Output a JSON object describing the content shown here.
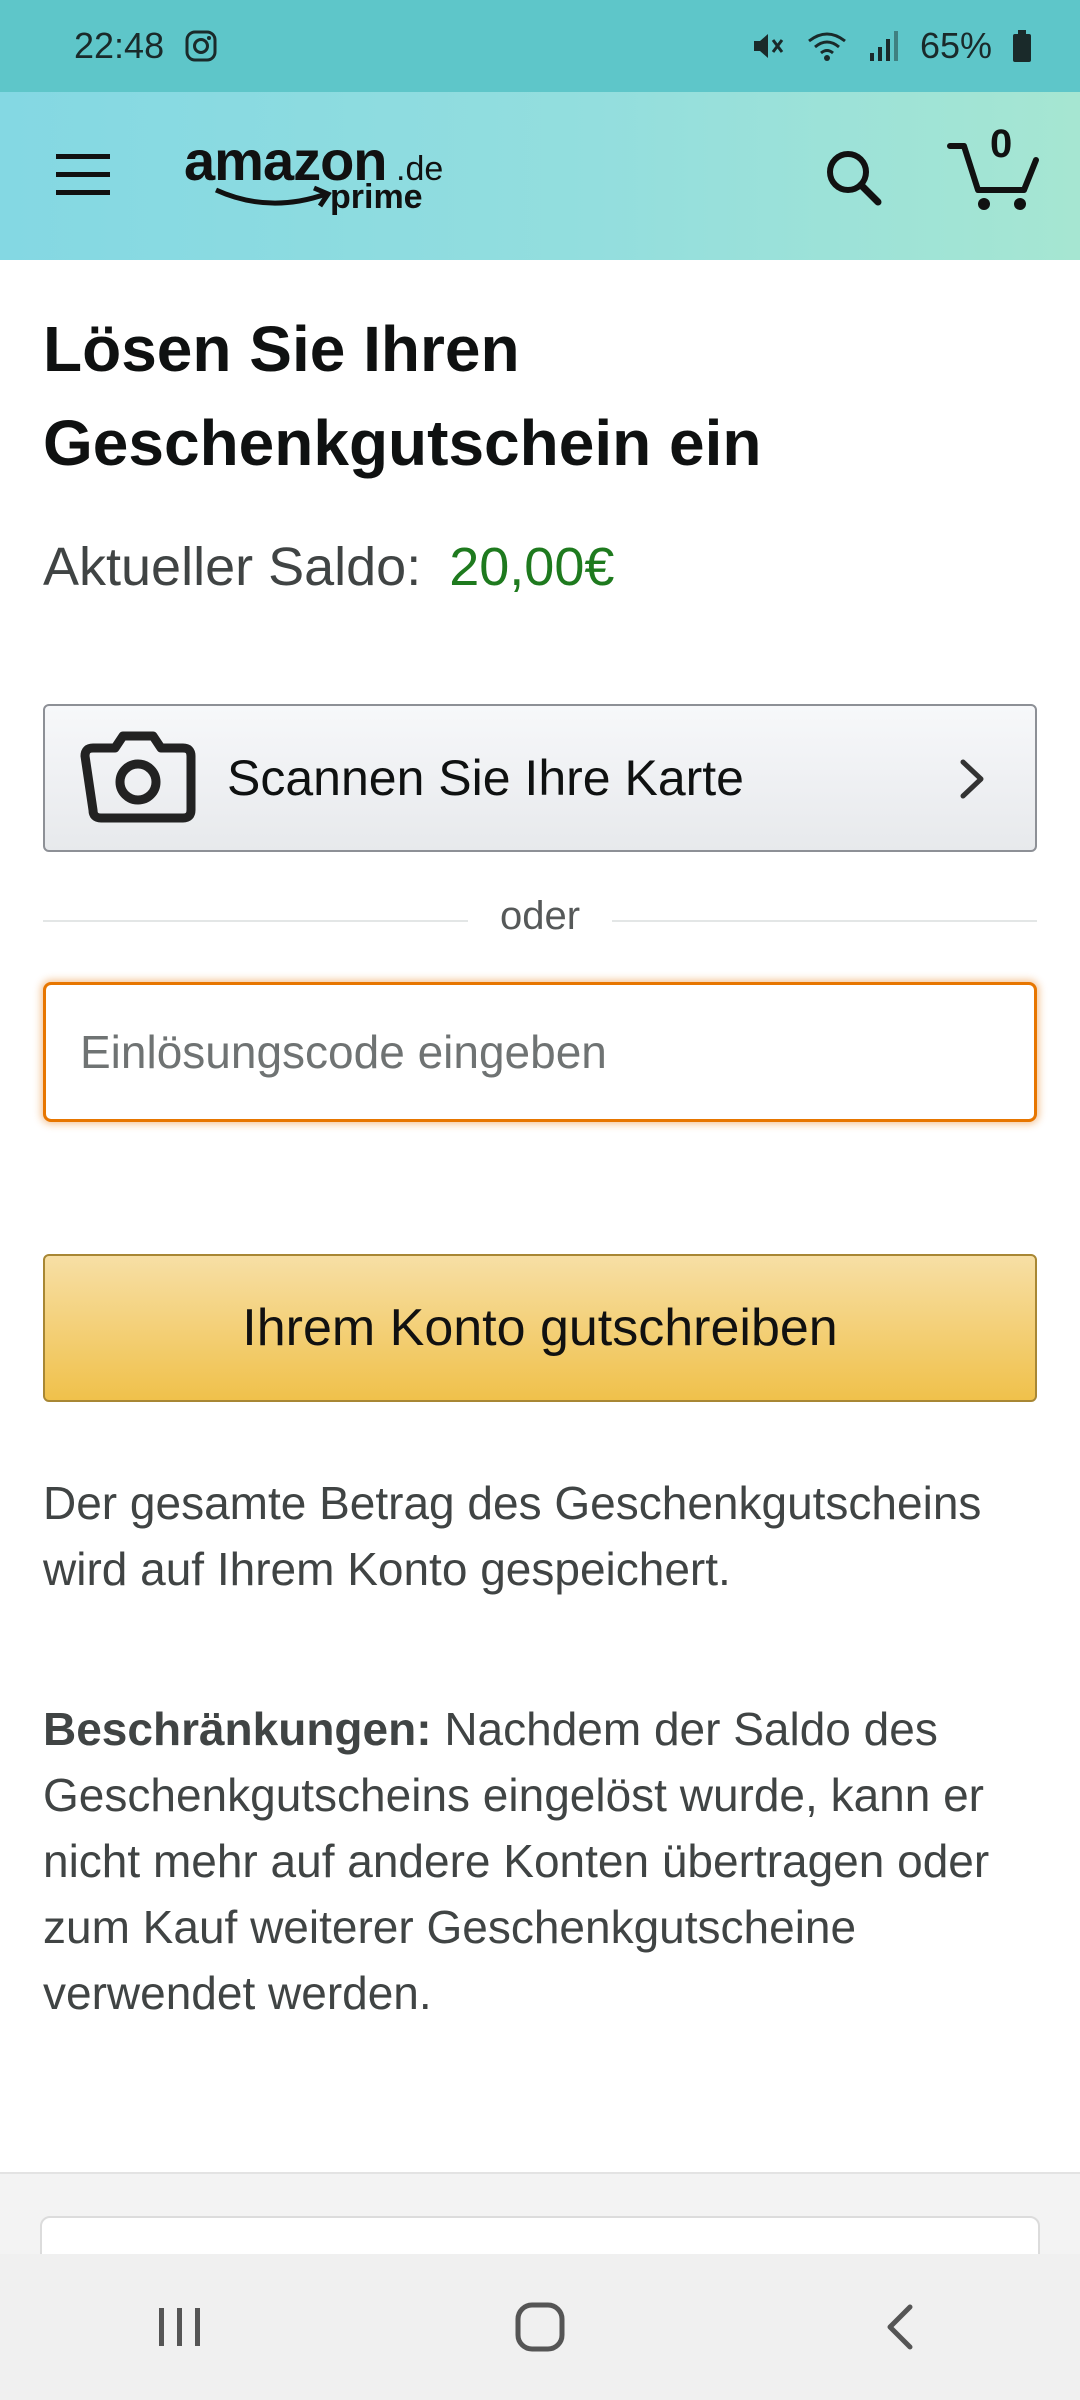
{
  "status_bar": {
    "time": "22:48",
    "battery": "65%"
  },
  "header": {
    "logo_word": "amazon",
    "logo_tld": ".de",
    "logo_sub": "prime",
    "cart_count": "0"
  },
  "main": {
    "title": "Lösen Sie Ihren Geschenkgutschein ein",
    "balance_label": "Aktueller Saldo:",
    "balance_value": "20,00€",
    "scan_label": "Scannen Sie Ihre Karte",
    "divider_text": "oder",
    "code_placeholder": "Einlösungscode eingeben",
    "submit_label": "Ihrem Konto gutschreiben",
    "info_text": "Der gesamte Betrag des Geschenkgutscheins wird auf Ihrem Konto gespeichert.",
    "restrictions_label": "Beschränkungen:",
    "restrictions_text": "Nachdem der Saldo des Geschenkgutscheins eingelöst wurde, kann er nicht mehr auf andere Konten übertragen oder zum Kauf weiterer Geschenkgutscheine verwendet werden."
  },
  "colors": {
    "status_bar": "#5ec6c9",
    "header_gradient_start": "#84d8e3",
    "header_gradient_end": "#a6e6d2",
    "balance_green": "#1e7a1e",
    "input_focus_orange": "#e77600",
    "submit_yellow": "#f0c14b"
  },
  "icons": {
    "status_left": [
      "instagram-icon"
    ],
    "status_right": [
      "mute-icon",
      "wifi-icon",
      "signal-icon",
      "battery-icon"
    ],
    "header": [
      "menu-icon",
      "search-icon",
      "cart-icon"
    ],
    "scan": [
      "camera-icon",
      "chevron-right-icon"
    ],
    "nav": [
      "recent-apps-icon",
      "home-icon",
      "back-icon"
    ]
  }
}
